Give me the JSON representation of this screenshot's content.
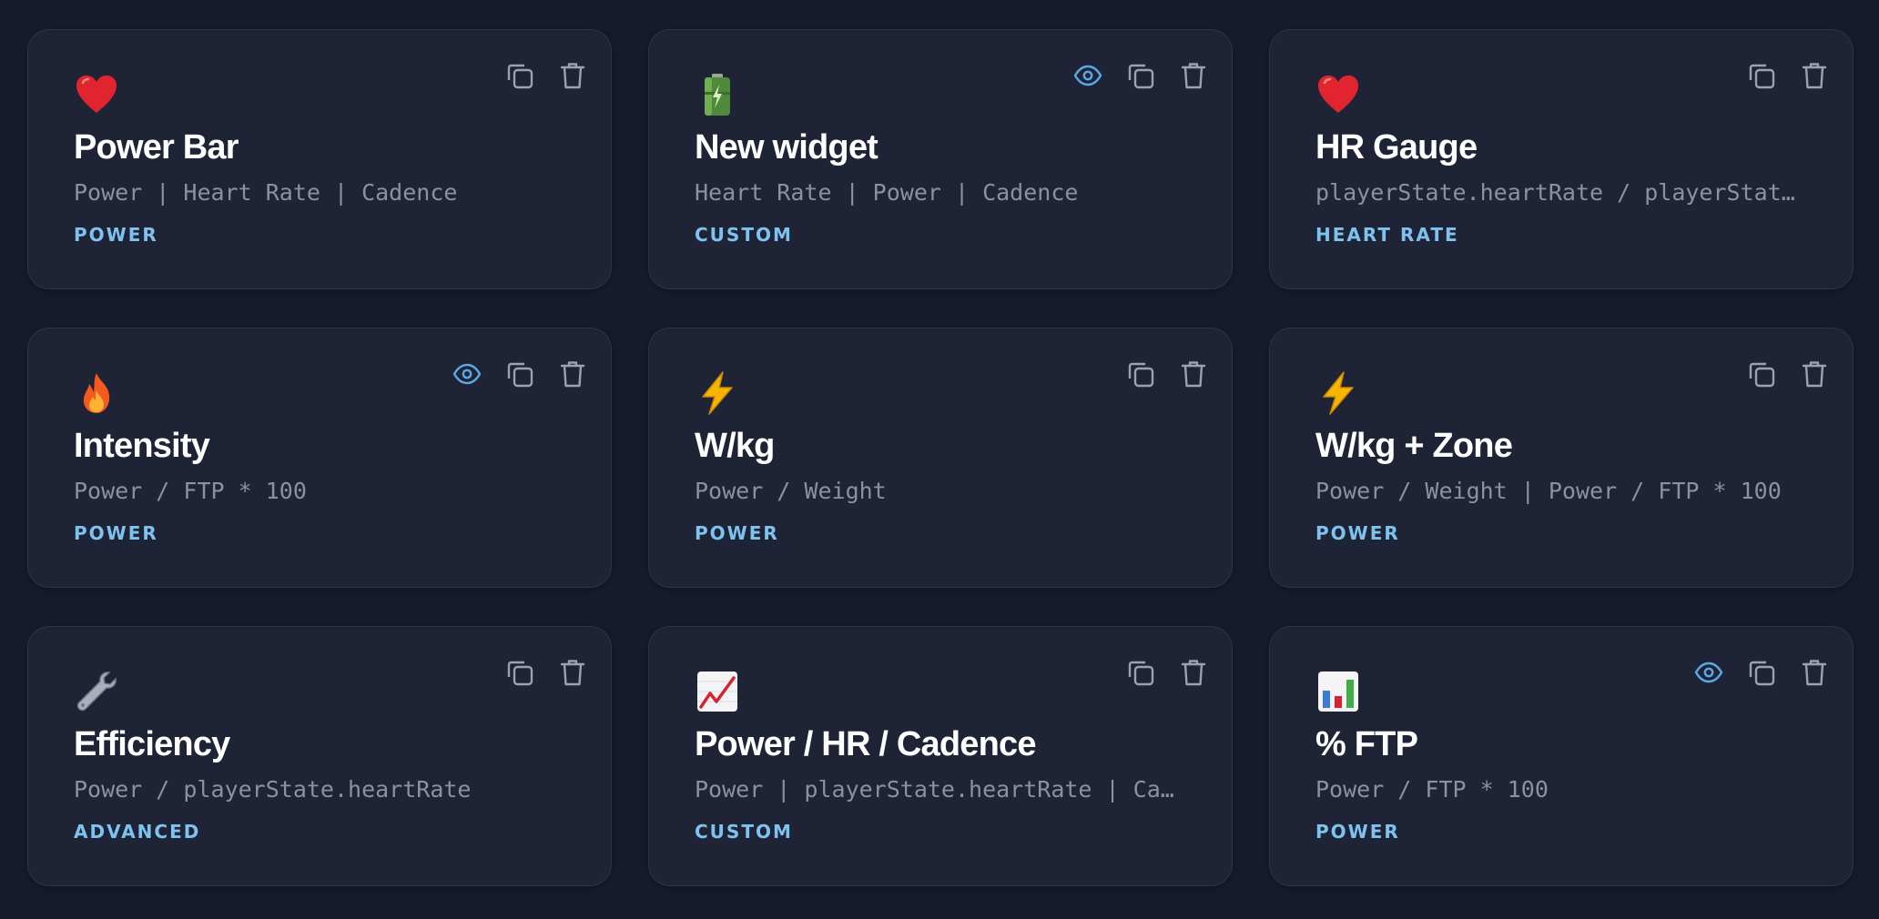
{
  "theme": {
    "background": "#151b2c",
    "card": "#1e2436",
    "accent": "#7ec3f0",
    "preview_icon": "#5aa9e6",
    "muted_icon": "#9aa1b2"
  },
  "widgets": [
    {
      "icon": "heart-icon",
      "title": "Power Bar",
      "formula": "Power | Heart Rate | Cadence",
      "category": "POWER",
      "preview": false
    },
    {
      "icon": "battery-icon",
      "title": "New widget",
      "formula": "Heart Rate | Power | Cadence",
      "category": "CUSTOM",
      "preview": true
    },
    {
      "icon": "heart-icon",
      "title": "HR Gauge",
      "formula": "playerState.heartRate / playerState.maxHeartRate",
      "category": "HEART RATE",
      "preview": false
    },
    {
      "icon": "fire-icon",
      "title": "Intensity",
      "formula": "Power / FTP * 100",
      "category": "POWER",
      "preview": true
    },
    {
      "icon": "lightning-icon",
      "title": "W/kg",
      "formula": "Power / Weight",
      "category": "POWER",
      "preview": false
    },
    {
      "icon": "lightning-icon",
      "title": "W/kg + Zone",
      "formula": "Power / Weight | Power / FTP * 100",
      "category": "POWER",
      "preview": false
    },
    {
      "icon": "wrench-icon",
      "title": "Efficiency",
      "formula": "Power / playerState.heartRate",
      "category": "ADVANCED",
      "preview": false
    },
    {
      "icon": "chart-increasing-icon",
      "title": "Power / HR / Cadence",
      "formula": "Power | playerState.heartRate | Cadence",
      "category": "CUSTOM",
      "preview": false
    },
    {
      "icon": "bar-chart-icon",
      "title": "% FTP",
      "formula": "Power / FTP * 100",
      "category": "POWER",
      "preview": true
    }
  ]
}
